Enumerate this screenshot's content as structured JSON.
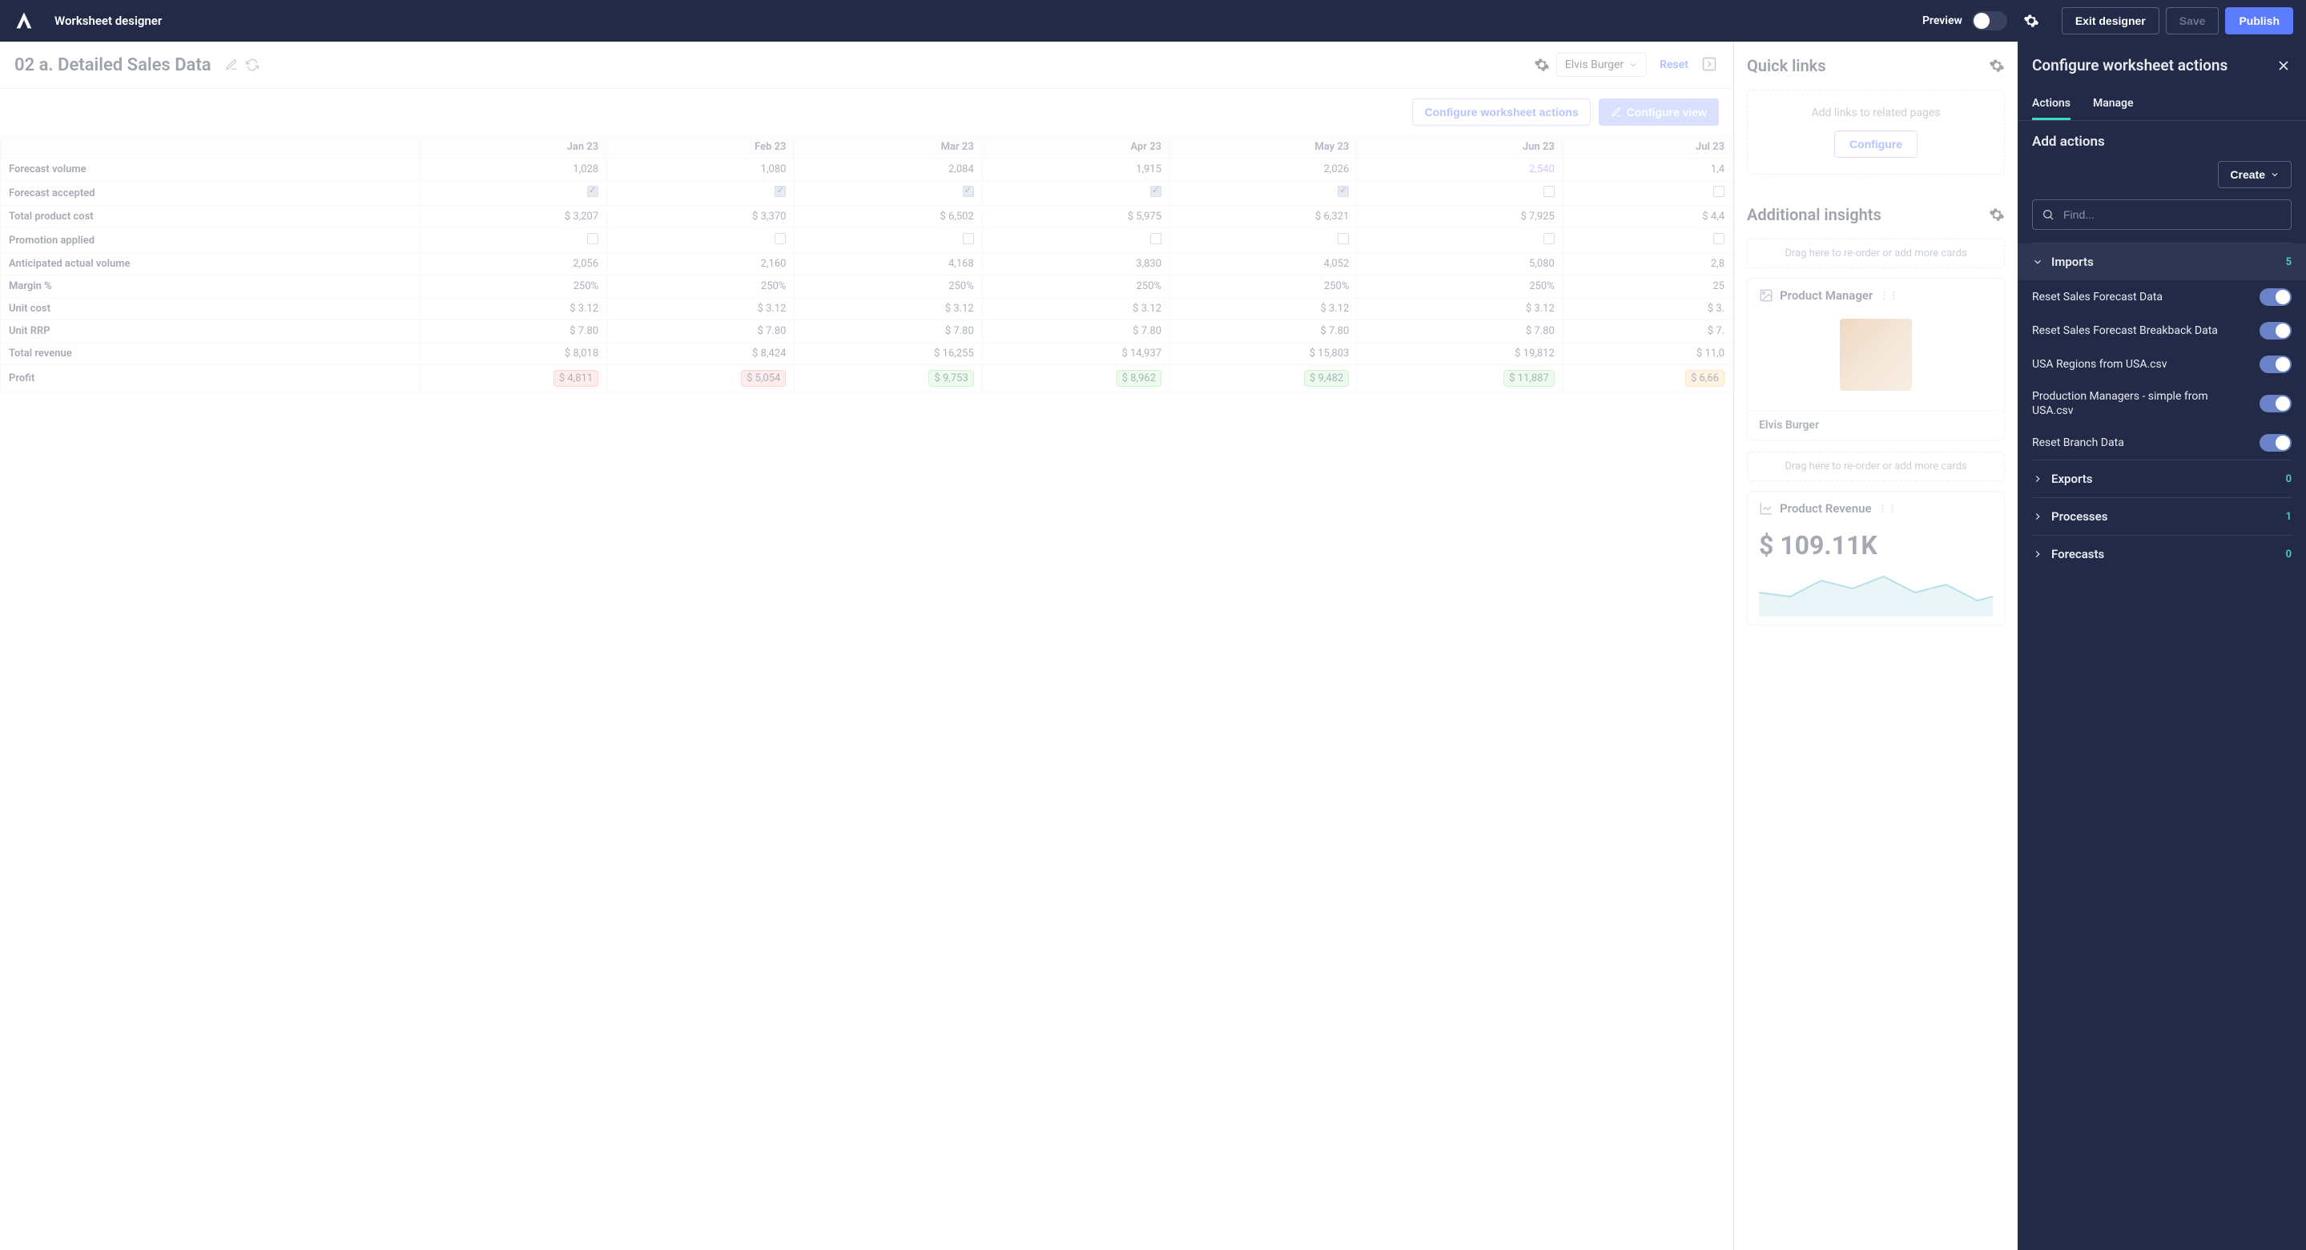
{
  "header": {
    "title": "Worksheet designer",
    "preview": "Preview",
    "exit": "Exit designer",
    "save": "Save",
    "publish": "Publish"
  },
  "worksheet": {
    "title": "02 a. Detailed Sales Data",
    "selector": "Elvis Burger",
    "reset": "Reset",
    "configure_actions": "Configure worksheet actions",
    "configure_view": "Configure view"
  },
  "table": {
    "columns": [
      "Jan 23",
      "Feb 23",
      "Mar 23",
      "Apr 23",
      "May 23",
      "Jun 23",
      "Jul 23"
    ],
    "rows": [
      {
        "label": "Forecast volume",
        "cells": [
          "1,028",
          "1,080",
          "2,084",
          "1,915",
          "2,026",
          "2,540",
          "1,4"
        ],
        "hl": 5
      },
      {
        "label": "Forecast accepted",
        "type": "check",
        "checks": [
          true,
          true,
          true,
          true,
          true,
          false,
          false
        ]
      },
      {
        "label": "Total product cost",
        "cells": [
          "$ 3,207",
          "$ 3,370",
          "$ 6,502",
          "$ 5,975",
          "$ 6,321",
          "$ 7,925",
          "$ 4,4"
        ]
      },
      {
        "label": "Promotion applied",
        "type": "check",
        "checks": [
          false,
          false,
          false,
          false,
          false,
          false,
          false
        ]
      },
      {
        "label": "Anticipated actual volume",
        "cells": [
          "2,056",
          "2,160",
          "4,168",
          "3,830",
          "4,052",
          "5,080",
          "2,8"
        ]
      },
      {
        "label": "Margin %",
        "cells": [
          "250%",
          "250%",
          "250%",
          "250%",
          "250%",
          "250%",
          "25"
        ]
      },
      {
        "label": "Unit cost",
        "cells": [
          "$ 3.12",
          "$ 3.12",
          "$ 3.12",
          "$ 3.12",
          "$ 3.12",
          "$ 3.12",
          "$ 3."
        ]
      },
      {
        "label": "Unit RRP",
        "cells": [
          "$ 7.80",
          "$ 7.80",
          "$ 7.80",
          "$ 7.80",
          "$ 7.80",
          "$ 7.80",
          "$ 7."
        ]
      },
      {
        "label": "Total revenue",
        "cells": [
          "$ 8,018",
          "$ 8,424",
          "$ 16,255",
          "$ 14,937",
          "$ 15,803",
          "$ 19,812",
          "$ 11,0"
        ]
      },
      {
        "label": "Profit",
        "type": "profit",
        "cells": [
          "$ 4,811",
          "$ 5,054",
          "$ 9,753",
          "$ 8,962",
          "$ 9,482",
          "$ 11,887",
          "$ 6,66"
        ],
        "colors": [
          "red",
          "red",
          "green",
          "green",
          "green",
          "green",
          "orange"
        ]
      }
    ]
  },
  "quicklinks": {
    "title": "Quick links",
    "text": "Add links to related pages",
    "btn": "Configure"
  },
  "insights": {
    "title": "Additional insights",
    "drop": "Drag here to re-order or add more cards",
    "card1_title": "Product Manager",
    "card1_name": "Elvis Burger",
    "card2_title": "Product Revenue",
    "card2_metric": "$ 109.11K"
  },
  "config": {
    "title": "Configure worksheet actions",
    "tab_actions": "Actions",
    "tab_manage": "Manage",
    "subtitle": "Add actions",
    "create": "Create",
    "find_placeholder": "Find...",
    "groups": [
      {
        "name": "Imports",
        "count": "5",
        "expanded": true,
        "items": [
          {
            "label": "Reset Sales Forecast Data",
            "on": true
          },
          {
            "label": "Reset Sales Forecast Breakback Data",
            "on": true
          },
          {
            "label": "USA Regions from USA.csv",
            "on": true
          },
          {
            "label": "Production Managers - simple from USA.csv",
            "on": true
          },
          {
            "label": "Reset Branch Data",
            "on": true
          }
        ]
      },
      {
        "name": "Exports",
        "count": "0",
        "expanded": false,
        "items": []
      },
      {
        "name": "Processes",
        "count": "1",
        "expanded": false,
        "items": []
      },
      {
        "name": "Forecasts",
        "count": "0",
        "expanded": false,
        "items": []
      }
    ]
  }
}
